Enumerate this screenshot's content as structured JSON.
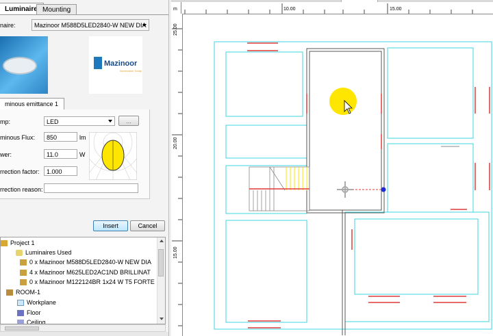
{
  "tabs": [
    "Luminaire",
    "Mounting"
  ],
  "luminaire": {
    "label": "naire:",
    "selected": "Mazinoor M588D5LED2840-W NEW DIA",
    "brand_name": "Mazinoor",
    "brand_tagline": "Illumination Today"
  },
  "emittance_tab": "minous emittance 1",
  "form": {
    "lamp_label": "mp:",
    "lamp_value": "LED",
    "lamp_btn": "...",
    "flux_label": "minous Flux:",
    "flux_value": "850",
    "flux_unit": "lm",
    "power_label": "wer:",
    "power_value": "11.0",
    "power_unit": "W",
    "correction_label": "rrection factor:",
    "correction_value": "1.000",
    "reason_label": "rrection reason:",
    "reason_value": ""
  },
  "buttons": {
    "insert": "Insert",
    "cancel": "Cancel"
  },
  "tree": [
    {
      "text": "Project 1",
      "indent": 0,
      "icon": "folder-icon"
    },
    {
      "text": "Luminaires Used",
      "indent": 1,
      "icon": "luminaires-icon"
    },
    {
      "text": "0 x Mazinoor M588D5LED2840-W NEW DIA",
      "indent": 2,
      "icon": "lamp-icon"
    },
    {
      "text": "4 x Mazinoor M625LED2AC1ND BRILLINAT",
      "indent": 2,
      "icon": "lamp-icon"
    },
    {
      "text": "0 x Mazinoor M122124BR 1x24 W T5 FORTE",
      "indent": 2,
      "icon": "lamp-icon"
    },
    {
      "text": "ROOM-1",
      "indent": 0,
      "icon": "room-icon"
    },
    {
      "text": "Workplane",
      "indent": 1,
      "icon": "workplane-icon"
    },
    {
      "text": "Floor",
      "indent": 1,
      "icon": "floor-icon"
    },
    {
      "text": "Ceiling",
      "indent": 1,
      "icon": "ceiling-icon"
    }
  ],
  "ruler": {
    "unit": "m",
    "top_labels": [
      "10.00",
      "15.00"
    ],
    "left_labels": [
      "25.00",
      "20.00",
      "15.00"
    ]
  },
  "colors": {
    "cyan": "#3fd6e0",
    "red": "#e03a3a",
    "yellow": "#ffe600",
    "blue": "#1d2bd8"
  }
}
